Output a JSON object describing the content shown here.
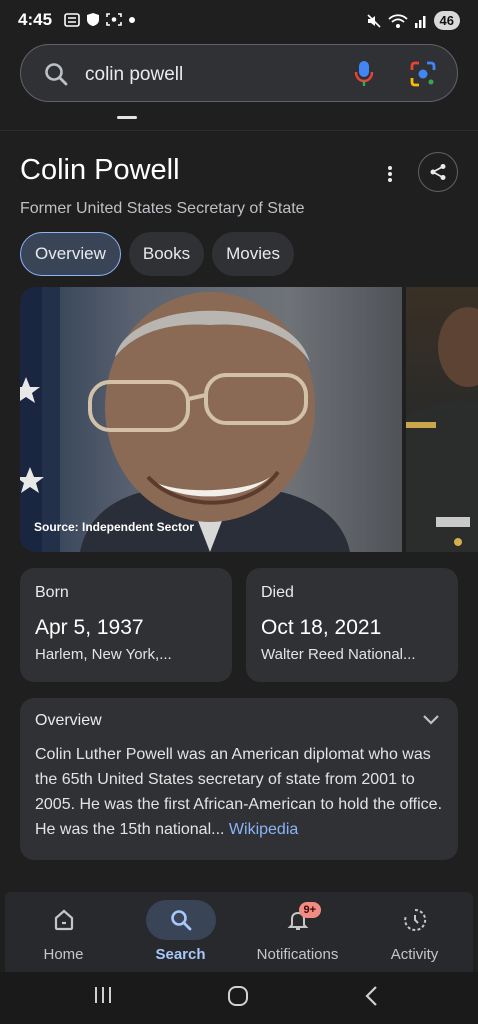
{
  "status_bar": {
    "time": "4:45",
    "battery": "46"
  },
  "search": {
    "query": "colin powell"
  },
  "knowledge_panel": {
    "title": "Colin Powell",
    "subtitle": "Former United States Secretary of State",
    "chips": [
      {
        "label": "Overview",
        "active": true
      },
      {
        "label": "Books",
        "active": false
      },
      {
        "label": "Movies",
        "active": false
      }
    ],
    "image_caption": "Source: Independent Sector",
    "born": {
      "label": "Born",
      "date": "Apr 5, 1937",
      "place": "Harlem, New York,..."
    },
    "died": {
      "label": "Died",
      "date": "Oct 18, 2021",
      "place": "Walter Reed National..."
    },
    "overview": {
      "title": "Overview",
      "text": "Colin Luther Powell was an American diplomat who was the 65th United States secretary of state from 2001 to 2005. He was the first African-American to hold the office. He was the 15th national",
      "ellipsis": "... ",
      "link": "Wikipedia"
    }
  },
  "bottom_nav": {
    "items": [
      {
        "label": "Home",
        "icon": "home-icon"
      },
      {
        "label": "Search",
        "icon": "search-icon"
      },
      {
        "label": "Notifications",
        "icon": "bell-icon",
        "badge": "9+"
      },
      {
        "label": "Activity",
        "icon": "activity-icon"
      }
    ]
  },
  "colors": {
    "background": "#1f1f1f",
    "card": "#303134",
    "accent": "#8ab4f8",
    "active_chip": "#394457"
  }
}
